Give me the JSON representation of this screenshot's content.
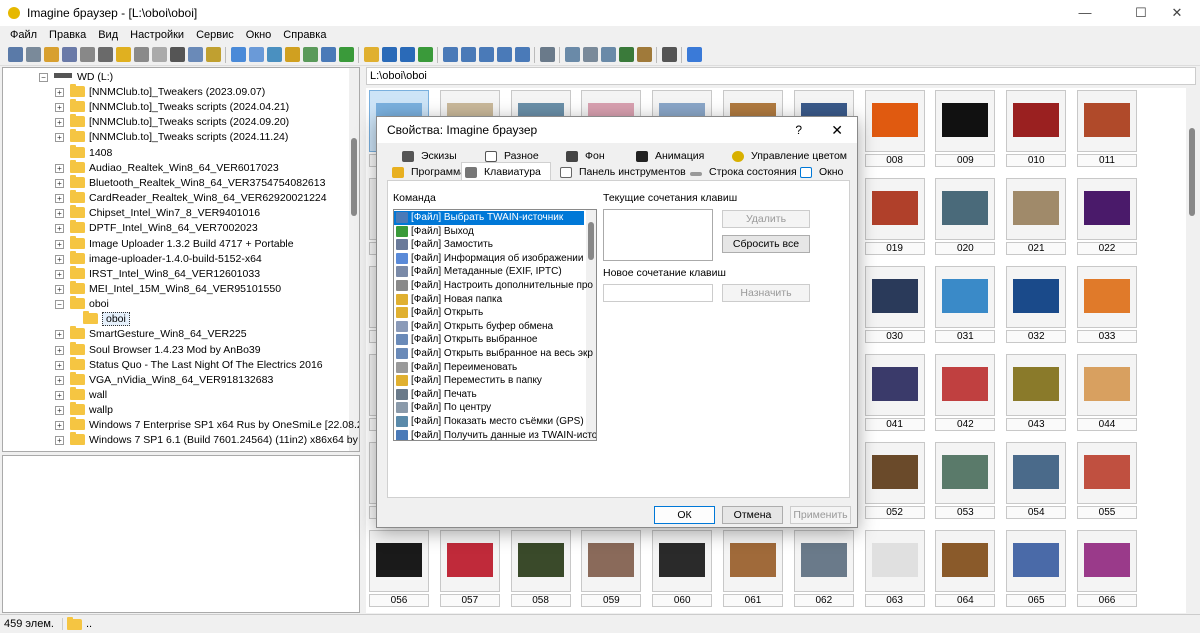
{
  "window": {
    "title": "Imagine браузер - [L:\\oboi\\oboi]",
    "minimize": "—",
    "maximize": "☐",
    "close": "✕"
  },
  "menu": [
    "Файл",
    "Правка",
    "Вид",
    "Настройки",
    "Сервис",
    "Окно",
    "Справка"
  ],
  "tree": {
    "drive": "WD (L:)",
    "folders": [
      {
        "name": "[NNMClub.to]_Tweakers (2023.09.07)",
        "expandable": true
      },
      {
        "name": "[NNMClub.to]_Tweaks scripts (2024.04.21)",
        "expandable": true
      },
      {
        "name": "[NNMClub.to]_Tweaks scripts (2024.09.20)",
        "expandable": true
      },
      {
        "name": "[NNMClub.to]_Tweaks scripts (2024.11.24)",
        "expandable": true
      },
      {
        "name": "1408",
        "expandable": false
      },
      {
        "name": "Audiao_Realtek_Win8_64_VER6017023",
        "expandable": true
      },
      {
        "name": "Bluetooth_Realtek_Win8_64_VER3754754082613",
        "expandable": true
      },
      {
        "name": "CardReader_Realtek_Win8_64_VER62920021224",
        "expandable": true
      },
      {
        "name": "Chipset_Intel_Win7_8_VER9401016",
        "expandable": true
      },
      {
        "name": "DPTF_Intel_Win8_64_VER7002023",
        "expandable": true
      },
      {
        "name": "Image Uploader 1.3.2 Build 4717 + Portable",
        "expandable": true
      },
      {
        "name": "image-uploader-1.4.0-build-5152-x64",
        "expandable": true
      },
      {
        "name": "IRST_Intel_Win8_64_VER12601033",
        "expandable": true
      },
      {
        "name": "MEI_Intel_15M_Win8_64_VER95101550",
        "expandable": true
      },
      {
        "name": "oboi",
        "expandable": true,
        "expanded": true
      },
      {
        "name": "oboi",
        "child": true,
        "selected": true
      },
      {
        "name": "SmartGesture_Win8_64_VER225",
        "expandable": true
      },
      {
        "name": "Soul Browser 1.4.23 Mod by AnBo39",
        "expandable": true
      },
      {
        "name": "Status Quo - The Last Night Of The Electrics 2016",
        "expandable": true
      },
      {
        "name": "VGA_nVidia_Win8_64_VER918132683",
        "expandable": true
      },
      {
        "name": "wall",
        "expandable": true
      },
      {
        "name": "wallp",
        "expandable": true
      },
      {
        "name": "Windows 7 Enterprise SP1 x64 Rus by OneSmiLe [22.08.202",
        "expandable": true
      },
      {
        "name": "Windows 7 SP1 6.1 (Build 7601.24564) (11in2) x86x64 by Sa",
        "expandable": true
      }
    ]
  },
  "path": "L:\\oboi\\oboi",
  "thumbnails": [
    {
      "label": "",
      "color": "#7ab0de"
    },
    {
      "label": "",
      "color": "#c9b89a"
    },
    {
      "label": "",
      "color": "#6a8fa8"
    },
    {
      "label": "",
      "color": "#d8a0b0"
    },
    {
      "label": "",
      "color": "#8aa6c8"
    },
    {
      "label": "",
      "color": "#b07a40"
    },
    {
      "label": "",
      "color": "#3a5a8a"
    },
    {
      "label": "008",
      "color": "#e05a10"
    },
    {
      "label": "009",
      "color": "#111111"
    },
    {
      "label": "010",
      "color": "#9a2020"
    },
    {
      "label": "011",
      "color": "#b04a2a"
    },
    {
      "label": "",
      "color": "#ccc"
    },
    {
      "label": "",
      "color": "#ccc"
    },
    {
      "label": "",
      "color": "#ccc"
    },
    {
      "label": "",
      "color": "#ccc"
    },
    {
      "label": "",
      "color": "#ccc"
    },
    {
      "label": "",
      "color": "#ccc"
    },
    {
      "label": "",
      "color": "#ccc"
    },
    {
      "label": "019",
      "color": "#b0402a"
    },
    {
      "label": "020",
      "color": "#4a6a7a"
    },
    {
      "label": "021",
      "color": "#a08a6a"
    },
    {
      "label": "022",
      "color": "#4a1a6a"
    },
    {
      "label": "",
      "color": "#ccc"
    },
    {
      "label": "",
      "color": "#ccc"
    },
    {
      "label": "",
      "color": "#ccc"
    },
    {
      "label": "",
      "color": "#ccc"
    },
    {
      "label": "",
      "color": "#ccc"
    },
    {
      "label": "",
      "color": "#ccc"
    },
    {
      "label": "",
      "color": "#ccc"
    },
    {
      "label": "030",
      "color": "#2a3a5a"
    },
    {
      "label": "031",
      "color": "#3a8ac8"
    },
    {
      "label": "032",
      "color": "#1a4a8a"
    },
    {
      "label": "033",
      "color": "#e07a2a"
    },
    {
      "label": "",
      "color": "#ccc"
    },
    {
      "label": "",
      "color": "#ccc"
    },
    {
      "label": "",
      "color": "#ccc"
    },
    {
      "label": "",
      "color": "#ccc"
    },
    {
      "label": "",
      "color": "#ccc"
    },
    {
      "label": "",
      "color": "#ccc"
    },
    {
      "label": "",
      "color": "#ccc"
    },
    {
      "label": "041",
      "color": "#3a3a6a"
    },
    {
      "label": "042",
      "color": "#c04040"
    },
    {
      "label": "043",
      "color": "#8a7a2a"
    },
    {
      "label": "044",
      "color": "#d8a060"
    },
    {
      "label": "",
      "color": "#ccc"
    },
    {
      "label": "",
      "color": "#ccc"
    },
    {
      "label": "",
      "color": "#ccc"
    },
    {
      "label": "",
      "color": "#ccc"
    },
    {
      "label": "",
      "color": "#ccc"
    },
    {
      "label": "",
      "color": "#ccc"
    },
    {
      "label": "",
      "color": "#ccc"
    },
    {
      "label": "052",
      "color": "#6a4a2a"
    },
    {
      "label": "053",
      "color": "#5a7a6a"
    },
    {
      "label": "054",
      "color": "#4a6a8a"
    },
    {
      "label": "055",
      "color": "#c05040"
    },
    {
      "label": "056",
      "color": "#1a1a1a"
    },
    {
      "label": "057",
      "color": "#c02a3a"
    },
    {
      "label": "058",
      "color": "#3a4a2a"
    },
    {
      "label": "059",
      "color": "#8a6a5a"
    },
    {
      "label": "060",
      "color": "#2a2a2a"
    },
    {
      "label": "061",
      "color": "#a06a3a"
    },
    {
      "label": "062",
      "color": "#6a7a8a"
    },
    {
      "label": "063",
      "color": "#e0e0e0"
    },
    {
      "label": "064",
      "color": "#8a5a2a"
    },
    {
      "label": "065",
      "color": "#4a6aa8"
    },
    {
      "label": "066",
      "color": "#9a3a8a"
    }
  ],
  "status": {
    "count": "459 элем.",
    "folder": ".."
  },
  "dialog": {
    "title": "Свойства: Imagine браузер",
    "help": "?",
    "close": "✕",
    "tabs_row1": [
      "Эскизы",
      "Разное",
      "Фон",
      "Анимация",
      "Управление цветом"
    ],
    "tabs_row2": [
      "Программа",
      "Клавиатура",
      "Панель инструментов",
      "Строка состояния",
      "Окно"
    ],
    "command_label": "Команда",
    "commands": [
      "[Файл] Выбрать TWAIN-источник",
      "[Файл] Выход",
      "[Файл] Замостить",
      "[Файл] Информация об изображении",
      "[Файл] Метаданные (EXIF, IPTC)",
      "[Файл] Настроить дополнительные про",
      "[Файл] Новая папка",
      "[Файл] Открыть",
      "[Файл] Открыть буфер обмена",
      "[Файл] Открыть выбранное",
      "[Файл] Открыть выбранное на весь экр",
      "[Файл] Переименовать",
      "[Файл] Переместить в папку",
      "[Файл] Печать",
      "[Файл] По центру",
      "[Файл] Показать место съёмки (GPS)",
      "[Файл] Получить данные из TWAIN-исто"
    ],
    "current_keys_label": "Текущие сочетания клавиш",
    "new_key_label": "Новое сочетание клавиш",
    "delete_btn": "Удалить",
    "reset_btn": "Сбросить все",
    "assign_btn": "Назначить",
    "ok_btn": "ОК",
    "cancel_btn": "Отмена",
    "apply_btn": "Применить"
  },
  "colors": {
    "accent": "#0078d7",
    "folder": "#f5c542"
  }
}
